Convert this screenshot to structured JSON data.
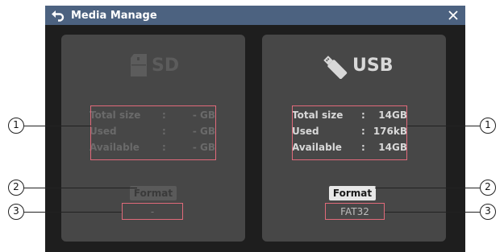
{
  "window": {
    "title": "Media Manage"
  },
  "sd": {
    "name": "SD",
    "info": [
      {
        "label": "Total size",
        "value": "- GB"
      },
      {
        "label": "Used",
        "value": "- GB"
      },
      {
        "label": "Available",
        "value": "- GB"
      }
    ],
    "format_label": "Format",
    "filesystem": "-"
  },
  "usb": {
    "name": "USB",
    "info": [
      {
        "label": "Total size",
        "value": "14GB"
      },
      {
        "label": "Used",
        "value": "176kB"
      },
      {
        "label": "Available",
        "value": "14GB"
      }
    ],
    "format_label": "Format",
    "filesystem": "FAT32"
  },
  "separator": ":",
  "callouts": {
    "info": "1",
    "format": "2",
    "filesystem": "3"
  },
  "icons": {
    "back": "back-arrow-icon",
    "close": "close-icon",
    "sd": "sd-card-icon",
    "usb": "usb-stick-icon"
  },
  "colors": {
    "titlebar": "#4c6280",
    "panel": "#474747",
    "highlight_box": "#e06a7a"
  }
}
